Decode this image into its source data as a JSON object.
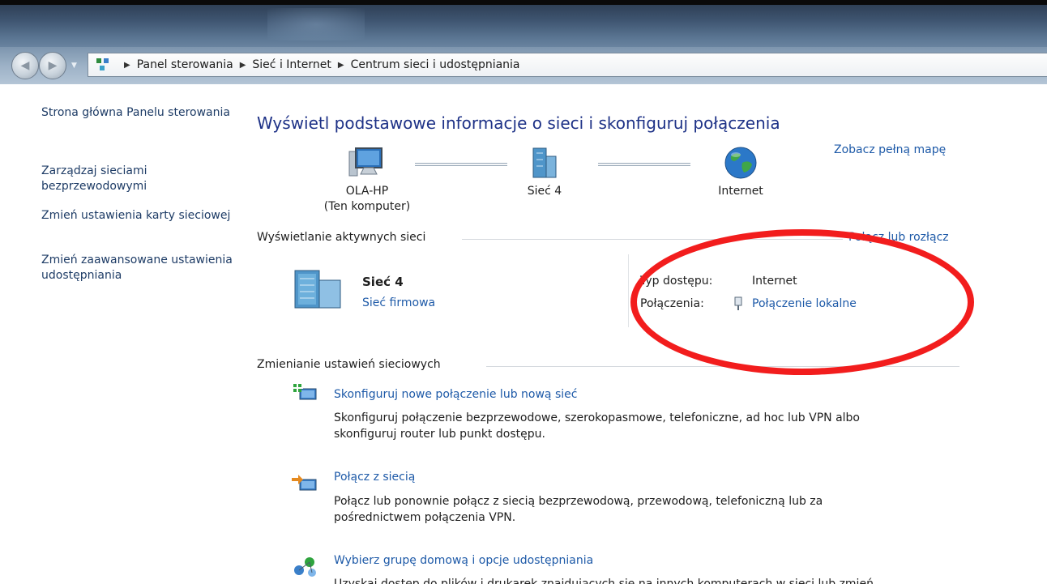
{
  "nav": {
    "back_icon": "back-arrow-icon",
    "forward_icon": "forward-arrow-icon",
    "breadcrumb": [
      "Panel sterowania",
      "Sieć i Internet",
      "Centrum sieci i udostępniania"
    ]
  },
  "sidebar": {
    "items": [
      {
        "label": "Strona główna Panelu sterowania"
      },
      {
        "label": "Zarządzaj sieciami bezprzewodowymi"
      },
      {
        "label": "Zmień ustawienia karty sieciowej"
      },
      {
        "label": "Zmień zaawansowane ustawienia udostępniania"
      }
    ]
  },
  "main": {
    "title": "Wyświetl podstawowe informacje o sieci i skonfiguruj połączenia",
    "map_link": "Zobacz pełną mapę",
    "map": {
      "computer_name": "OLA-HP",
      "computer_sub": "(Ten komputer)",
      "network": "Sieć 4",
      "internet": "Internet"
    },
    "active_section": "Wyświetlanie aktywnych sieci",
    "connect_link": "Połącz lub rozłącz",
    "active_network": {
      "name": "Sieć 4",
      "type": "Sieć firmowa",
      "access_type_label": "Typ dostępu:",
      "access_type_value": "Internet",
      "connections_label": "Połączenia:",
      "connections_value": "Połączenie lokalne"
    },
    "change_section": "Zmienianie ustawień sieciowych",
    "tasks": [
      {
        "title": "Skonfiguruj nowe połączenie lub nową sieć",
        "desc": "Skonfiguruj połączenie bezprzewodowe, szerokopasmowe, telefoniczne, ad hoc lub VPN albo skonfiguruj router lub punkt dostępu."
      },
      {
        "title": "Połącz z siecią",
        "desc": "Połącz lub ponownie połącz z siecią bezprzewodową, przewodową, telefoniczną lub za pośrednictwem połączenia VPN."
      },
      {
        "title": "Wybierz grupę domową i opcje udostępniania",
        "desc": "Uzyskaj dostęp do plików i drukarek znajdujących się na innych komputerach w sieci lub zmień"
      }
    ]
  },
  "colors": {
    "link": "#1e5aa8",
    "title": "#1e3287",
    "annotation": "#f21d1d"
  }
}
